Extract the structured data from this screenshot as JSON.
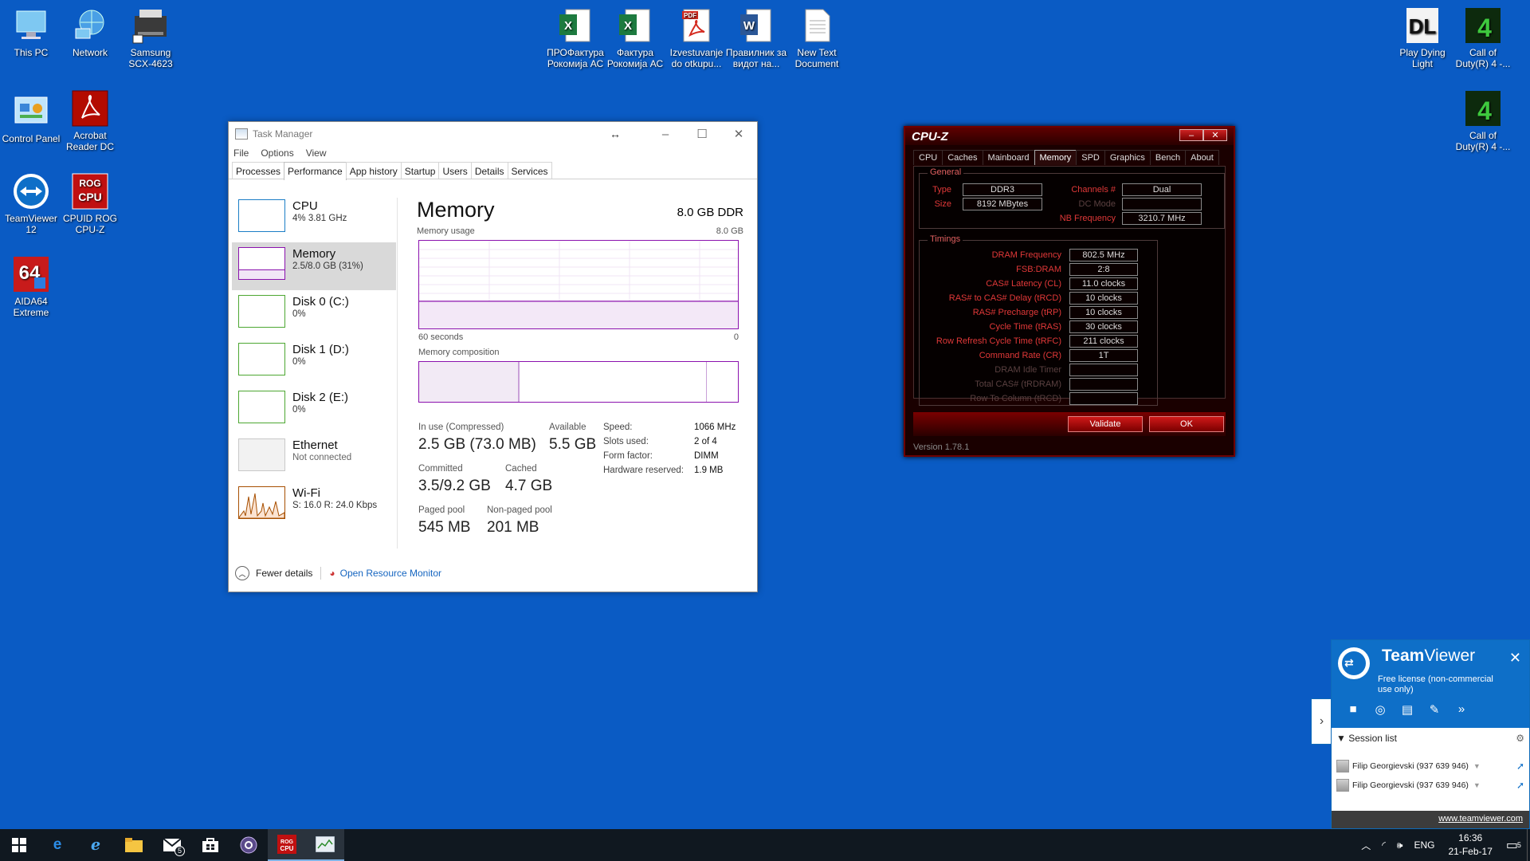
{
  "desktop": {
    "icons": [
      {
        "label": "This PC",
        "icon": "computer-icon"
      },
      {
        "label": "Network",
        "icon": "network-icon"
      },
      {
        "label": "Samsung SCX-4623",
        "icon": "printer-icon"
      },
      {
        "label": "Control Panel",
        "icon": "control-panel-icon"
      },
      {
        "label": "Acrobat Reader DC",
        "icon": "acrobat-icon"
      },
      {
        "label": "TeamViewer 12",
        "icon": "teamviewer-icon"
      },
      {
        "label": "CPUID ROG CPU-Z",
        "icon": "cpuz-icon"
      },
      {
        "label": "AIDA64 Extreme",
        "icon": "aida64-icon"
      },
      {
        "label": "ПРОФактура Рокомија АС",
        "icon": "excel-icon"
      },
      {
        "label": "Фактура Рокомија АС",
        "icon": "excel-icon"
      },
      {
        "label": "Izvestuvanje do otkupu...",
        "icon": "pdf-icon"
      },
      {
        "label": "Правилник за видот на...",
        "icon": "word-icon"
      },
      {
        "label": "New Text Document",
        "icon": "text-document-icon"
      },
      {
        "label": "Play Dying Light",
        "icon": "game-icon"
      },
      {
        "label": "Call of Duty(R) 4 -...",
        "icon": "cod-icon"
      },
      {
        "label": "Call of Duty(R) 4 -...",
        "icon": "cod-icon"
      }
    ]
  },
  "task_manager": {
    "title": "Task Manager",
    "menu": [
      "File",
      "Options",
      "View"
    ],
    "tabs": [
      "Processes",
      "Performance",
      "App history",
      "Startup",
      "Users",
      "Details",
      "Services"
    ],
    "active_tab": "Performance",
    "sidebar": [
      {
        "name": "CPU",
        "sub": "4% 3.81 GHz"
      },
      {
        "name": "Memory",
        "sub": "2.5/8.0 GB (31%)"
      },
      {
        "name": "Disk 0 (C:)",
        "sub": "0%"
      },
      {
        "name": "Disk 1 (D:)",
        "sub": "0%"
      },
      {
        "name": "Disk 2 (E:)",
        "sub": "0%"
      },
      {
        "name": "Ethernet",
        "sub": "Not connected"
      },
      {
        "name": "Wi-Fi",
        "sub": "S: 16.0 R: 24.0 Kbps"
      }
    ],
    "main": {
      "heading": "Memory",
      "capacity": "8.0 GB DDR",
      "usage_label": "Memory usage",
      "usage_max": "8.0 GB",
      "time_left": "60 seconds",
      "time_right": "0",
      "composition_label": "Memory composition",
      "usage_fraction": 0.31,
      "in_use_label": "In use (Compressed)",
      "in_use_value": "2.5 GB (73.0 MB)",
      "available_label": "Available",
      "available_value": "5.5 GB",
      "committed_label": "Committed",
      "committed_value": "3.5/9.2 GB",
      "cached_label": "Cached",
      "cached_value": "4.7 GB",
      "paged_label": "Paged pool",
      "paged_value": "545 MB",
      "nonpaged_label": "Non-paged pool",
      "nonpaged_value": "201 MB",
      "specs": [
        {
          "label": "Speed:",
          "value": "1066 MHz"
        },
        {
          "label": "Slots used:",
          "value": "2 of 4"
        },
        {
          "label": "Form factor:",
          "value": "DIMM"
        },
        {
          "label": "Hardware reserved:",
          "value": "1.9 MB"
        }
      ]
    },
    "footer": {
      "fewer": "Fewer details",
      "monitor": "Open Resource Monitor"
    }
  },
  "cpuz": {
    "title": "CPU-Z",
    "tabs": [
      "CPU",
      "Caches",
      "Mainboard",
      "Memory",
      "SPD",
      "Graphics",
      "Bench",
      "About"
    ],
    "active_tab": "Memory",
    "general_label": "General",
    "type_label": "Type",
    "type_value": "DDR3",
    "size_label": "Size",
    "size_value": "8192 MBytes",
    "channels_label": "Channels #",
    "channels_value": "Dual",
    "dcmode_label": "DC Mode",
    "dcmode_value": "",
    "nbfreq_label": "NB Frequency",
    "nbfreq_value": "3210.7 MHz",
    "timings_label": "Timings",
    "timings": [
      {
        "label": "DRAM Frequency",
        "value": "802.5 MHz",
        "dim": false
      },
      {
        "label": "FSB:DRAM",
        "value": "2:8",
        "dim": false
      },
      {
        "label": "CAS# Latency (CL)",
        "value": "11.0 clocks",
        "dim": false
      },
      {
        "label": "RAS# to CAS# Delay (tRCD)",
        "value": "10 clocks",
        "dim": false
      },
      {
        "label": "RAS# Precharge (tRP)",
        "value": "10 clocks",
        "dim": false
      },
      {
        "label": "Cycle Time (tRAS)",
        "value": "30 clocks",
        "dim": false
      },
      {
        "label": "Row Refresh Cycle Time (tRFC)",
        "value": "211 clocks",
        "dim": false
      },
      {
        "label": "Command Rate (CR)",
        "value": "1T",
        "dim": false
      },
      {
        "label": "DRAM Idle Timer",
        "value": "",
        "dim": true
      },
      {
        "label": "Total CAS# (tRDRAM)",
        "value": "",
        "dim": true
      },
      {
        "label": "Row To Column (tRCD)",
        "value": "",
        "dim": true
      }
    ],
    "validate": "Validate",
    "ok": "OK",
    "version": "Version 1.78.1"
  },
  "teamviewer": {
    "brand_a": "Team",
    "brand_b": "Viewer",
    "license": "Free license (non-commercial use only)",
    "session_list": "Session list",
    "sessions": [
      "Filip Georgievski (937 639 946)",
      "Filip Georgievski (937 639 946)"
    ],
    "url": "www.teamviewer.com"
  },
  "taskbar": {
    "notification_count": "5",
    "mail_badge": "5",
    "lang": "ENG",
    "time": "16:36",
    "date": "21-Feb-17"
  },
  "colors": {
    "desktop": "#0a5bc4",
    "memory_accent": "#8b12ae",
    "cpuz_red": "#e03838",
    "teamviewer_blue": "#0e6fc8"
  }
}
